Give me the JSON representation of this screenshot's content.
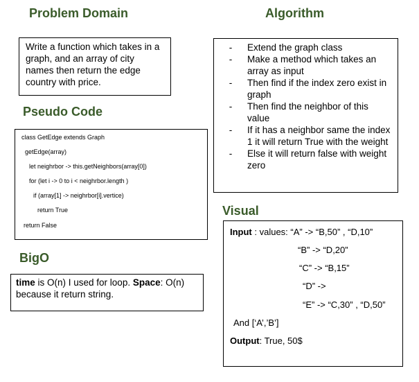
{
  "headings": {
    "problem_domain": "Problem Domain",
    "algorithm": "Algorithm",
    "pseudo_code": "Pseudo Code",
    "bigo": "BigO",
    "visual": "Visual"
  },
  "problem_domain": {
    "text": "Write a function which takes in a graph, and an array of city names then return the edge country with price."
  },
  "pseudo_code": {
    "lines": [
      "class GetEdge extends Graph",
      "getEdge(array)",
      "let neighrbor -> this.getNeighbors(array[0])",
      "for (let i -> 0  to  i < neighrbor.length )",
      "if (array[1] -> neighrbor[i].vertice)",
      "return True",
      "return False"
    ]
  },
  "algorithm": {
    "bullet": "-",
    "items": [
      "Extend the graph class",
      "Make a method which takes an array as input",
      "Then find if the index zero exist in graph",
      "Then find the neighbor of this value",
      "If it has a neighbor same the index 1 it will return True with the weight",
      "Else it will return false with weight zero"
    ]
  },
  "bigo": {
    "time_label": "time",
    "time_text": " is O(n) I used for loop. ",
    "space_label": "Space",
    "space_text": ": O(n) because it return string."
  },
  "visual": {
    "input_label": "Input",
    "input_text": " : values: “A” -> “B,50” , “D,10”",
    "lines": [
      "“B” -> “D,20”",
      "“C” -> “B,15”",
      "“D” ->",
      "“E” -> “C,30” , “D,50”"
    ],
    "and_text": "And [‘A’,’B’]",
    "output_label": "Output",
    "output_text": ": True, 50$"
  }
}
